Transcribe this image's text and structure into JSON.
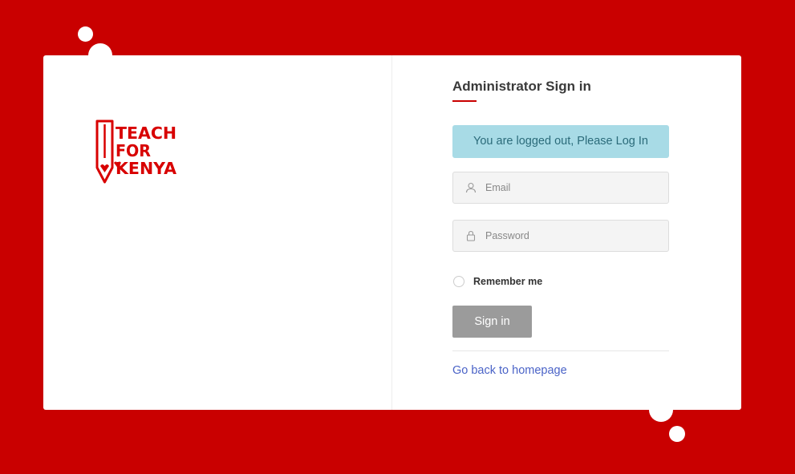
{
  "logo": {
    "line1": "TEACH",
    "line2": "FOR",
    "line3": "KENYA",
    "color": "#d80000"
  },
  "colors": {
    "background": "#c90000",
    "accent": "#c90000",
    "alert_bg": "#a8dbe6",
    "alert_text": "#2b6b7a",
    "link": "#4a63c7",
    "button_bg": "#9b9b9b"
  },
  "signin": {
    "title": "Administrator Sign in",
    "alert": "You are logged out, Please Log In",
    "email": {
      "placeholder": "Email",
      "value": "",
      "icon": "user-icon"
    },
    "password": {
      "placeholder": "Password",
      "value": "",
      "icon": "lock-icon"
    },
    "remember_label": "Remember me",
    "remember_checked": false,
    "submit_label": "Sign in",
    "back_link": "Go back to homepage"
  }
}
